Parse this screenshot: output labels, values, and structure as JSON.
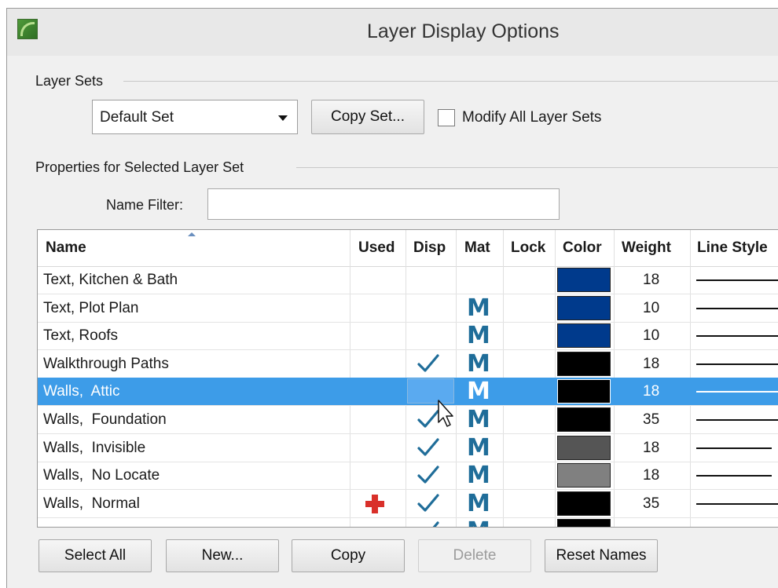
{
  "window": {
    "title": "Layer Display Options"
  },
  "layer_sets": {
    "group_label": "Layer Sets",
    "selected_set": "Default Set",
    "copy_set_button": "Copy Set...",
    "modify_all_label": "Modify All Layer Sets",
    "modify_all_checked": false
  },
  "properties": {
    "group_label": "Properties for Selected Layer Set",
    "name_filter_label": "Name Filter:",
    "name_filter_value": ""
  },
  "table": {
    "columns": [
      "Name",
      "Used",
      "Disp",
      "Mat",
      "Lock",
      "Color",
      "Weight",
      "Line Style"
    ],
    "rows": [
      {
        "name": "Text, Kitchen & Bath",
        "used": false,
        "disp": false,
        "mat": "",
        "lock": false,
        "color": "#003a8c",
        "weight": "18",
        "line": "solid",
        "selected": false
      },
      {
        "name": "Text, Plot Plan",
        "used": false,
        "disp": false,
        "mat": "M",
        "lock": false,
        "color": "#003a8c",
        "weight": "10",
        "line": "solid",
        "selected": false
      },
      {
        "name": "Text, Roofs",
        "used": false,
        "disp": false,
        "mat": "M",
        "lock": false,
        "color": "#003a8c",
        "weight": "10",
        "line": "solid",
        "selected": false
      },
      {
        "name": "Walkthrough Paths",
        "used": false,
        "disp": true,
        "mat": "M",
        "lock": false,
        "color": "#000000",
        "weight": "18",
        "line": "solid",
        "selected": false
      },
      {
        "name": "Walls,  Attic",
        "used": false,
        "disp": false,
        "mat": "M",
        "lock": false,
        "color": "#000000",
        "weight": "18",
        "line": "solid",
        "selected": true
      },
      {
        "name": "Walls,  Foundation",
        "used": false,
        "disp": true,
        "mat": "M",
        "lock": false,
        "color": "#000000",
        "weight": "35",
        "line": "solid",
        "selected": false
      },
      {
        "name": "Walls,  Invisible",
        "used": false,
        "disp": true,
        "mat": "M",
        "lock": false,
        "color": "#555555",
        "weight": "18",
        "line": "short",
        "selected": false
      },
      {
        "name": "Walls,  No Locate",
        "used": false,
        "disp": true,
        "mat": "M",
        "lock": false,
        "color": "#808080",
        "weight": "18",
        "line": "short",
        "selected": false
      },
      {
        "name": "Walls,  Normal",
        "used": true,
        "disp": true,
        "mat": "M",
        "lock": false,
        "color": "#000000",
        "weight": "35",
        "line": "solid",
        "selected": false
      },
      {
        "name": "",
        "used": false,
        "disp": true,
        "mat": "M",
        "lock": false,
        "color": "#000000",
        "weight": "",
        "line": "solid",
        "selected": false
      }
    ]
  },
  "buttons": {
    "select_all": "Select All",
    "new": "New...",
    "copy": "Copy",
    "delete": "Delete",
    "reset_names": "Reset Names"
  },
  "colors": {
    "selection": "#3d9ce8",
    "mat_icon": "#1f6d99",
    "used_plus": "#d9302a",
    "check": "#1f6d99"
  }
}
